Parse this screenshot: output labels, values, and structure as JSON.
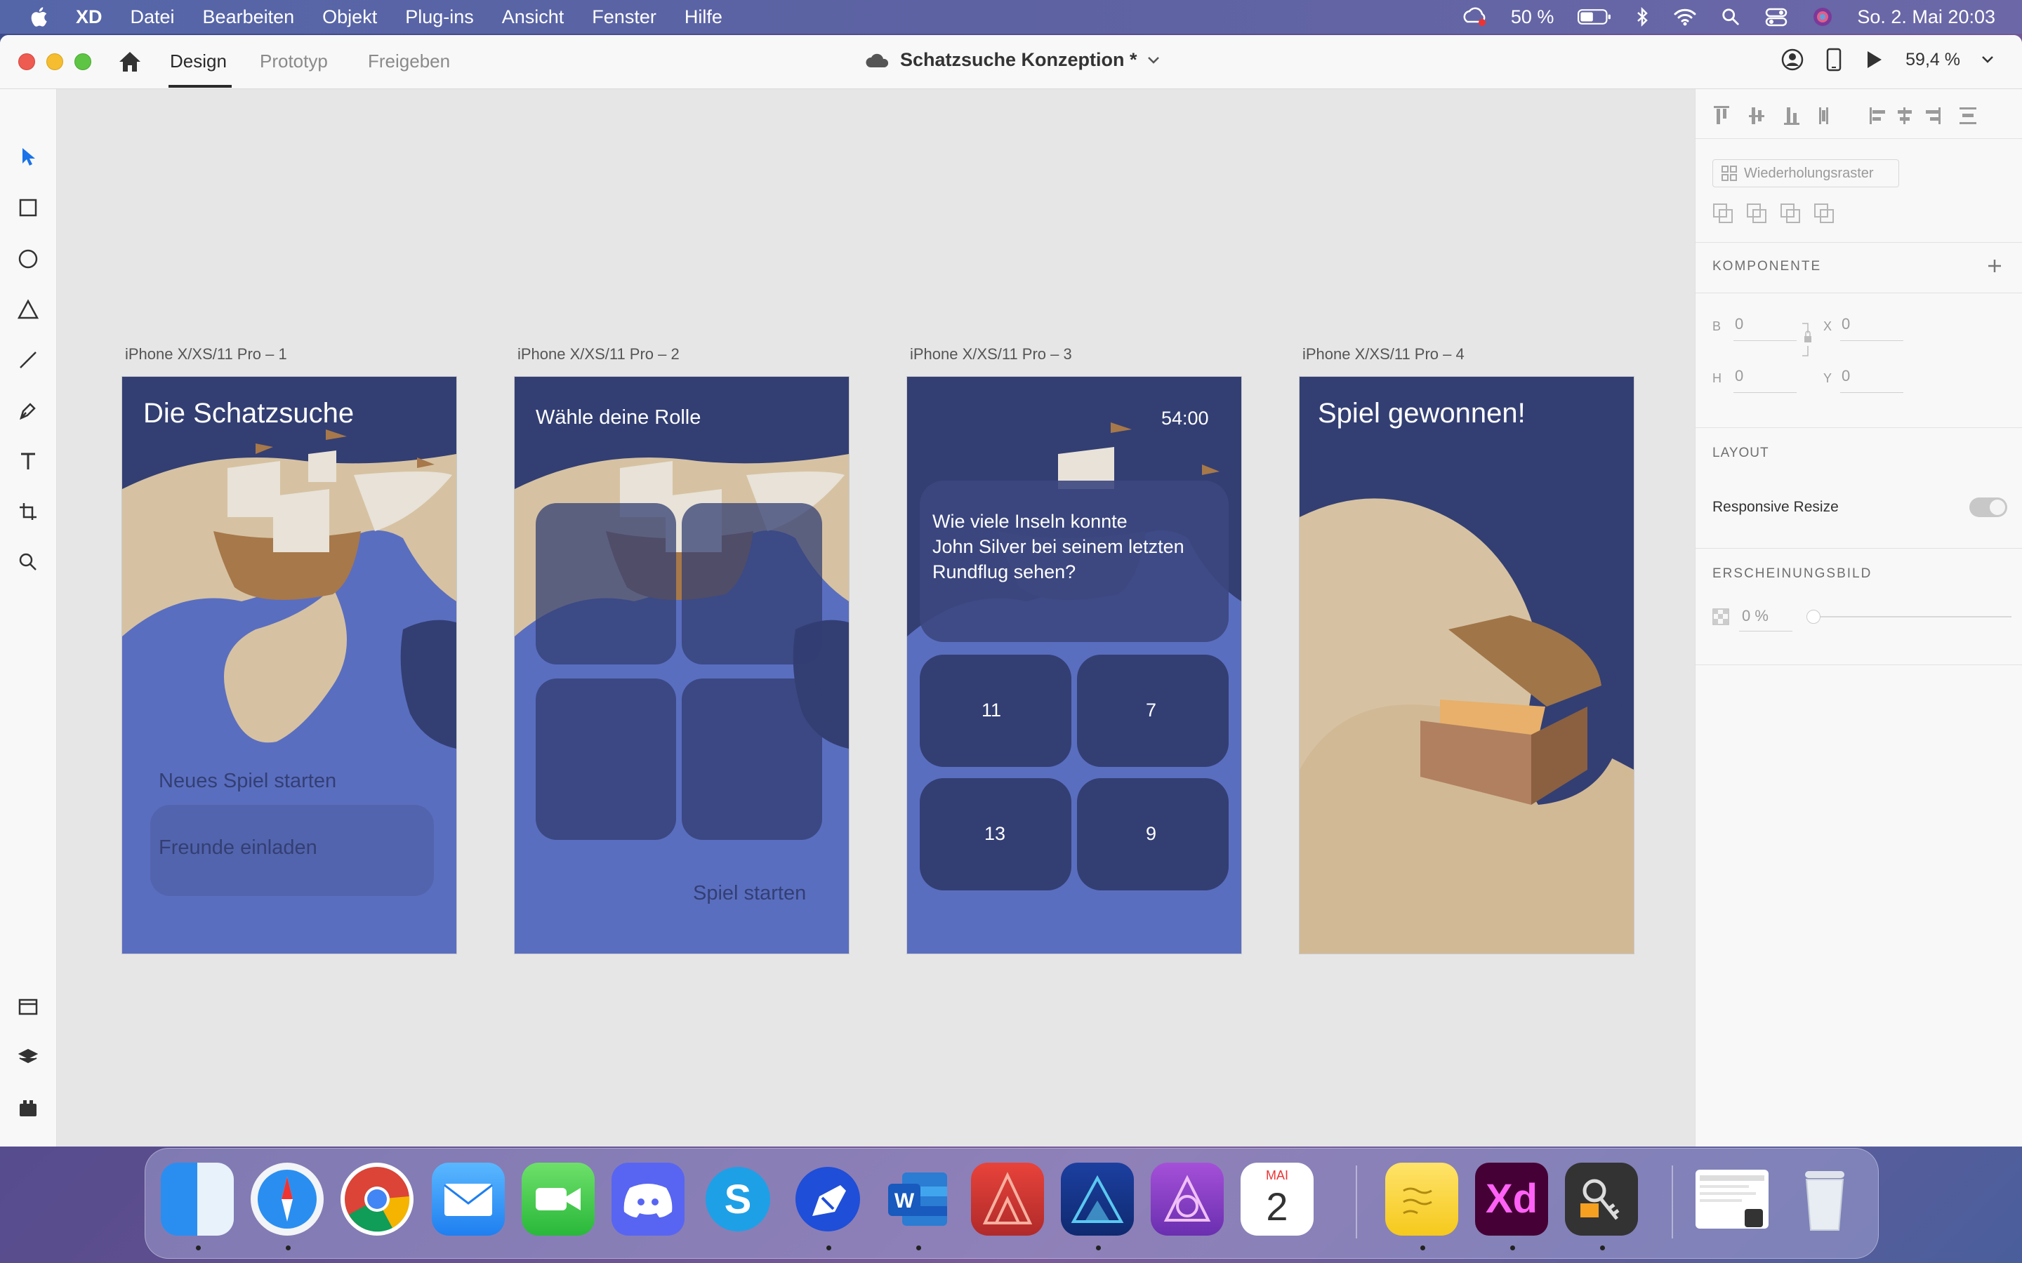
{
  "menubar": {
    "items": [
      "XD",
      "Datei",
      "Bearbeiten",
      "Objekt",
      "Plug-ins",
      "Ansicht",
      "Fenster",
      "Hilfe"
    ],
    "battery": "50 %",
    "datetime": "So. 2. Mai  20:03"
  },
  "titlebar": {
    "tabs": [
      "Design",
      "Prototyp",
      "Freigeben"
    ],
    "active_tab": "Design",
    "document_title": "Schatzsuche Konzeption *",
    "zoom": "59,4 %"
  },
  "artboards": [
    {
      "label": "iPhone X/XS/11 Pro – 1",
      "title": "Die Schatzsuche",
      "button1": "Neues Spiel starten",
      "button2": "Freunde einladen"
    },
    {
      "label": "iPhone X/XS/11 Pro – 2",
      "title": "Wähle deine Rolle",
      "footer": "Spiel starten"
    },
    {
      "label": "iPhone X/XS/11 Pro – 3",
      "timer": "54:00",
      "question_lines": [
        "Wie viele Inseln konnte",
        "John Silver bei seinem letzten",
        "Rundflug sehen?"
      ],
      "answers": [
        "11",
        "7",
        "13",
        "9"
      ]
    },
    {
      "label": "iPhone X/XS/11 Pro – 4",
      "title": "Spiel gewonnen!"
    }
  ],
  "right_panel": {
    "repeat_grid": "Wiederholungsraster",
    "component_heading": "KOMPONENTE",
    "fields": {
      "b_label": "B",
      "b_value": "0",
      "x_label": "X",
      "x_value": "0",
      "h_label": "H",
      "h_value": "0",
      "y_label": "Y",
      "y_value": "0"
    },
    "layout_heading": "LAYOUT",
    "responsive_resize": "Responsive Resize",
    "appearance_heading": "ERSCHEINUNGSBILD",
    "opacity": "0 %"
  },
  "dock": {
    "calendar_month": "MAI",
    "calendar_day": "2",
    "xd_label": "Xd"
  },
  "colors": {
    "navy": "#333f73",
    "mid_blue": "#5a6ec0",
    "sand": "#d6c2a2",
    "ship_brown": "#a7784a",
    "sail": "#e8e2d8"
  }
}
